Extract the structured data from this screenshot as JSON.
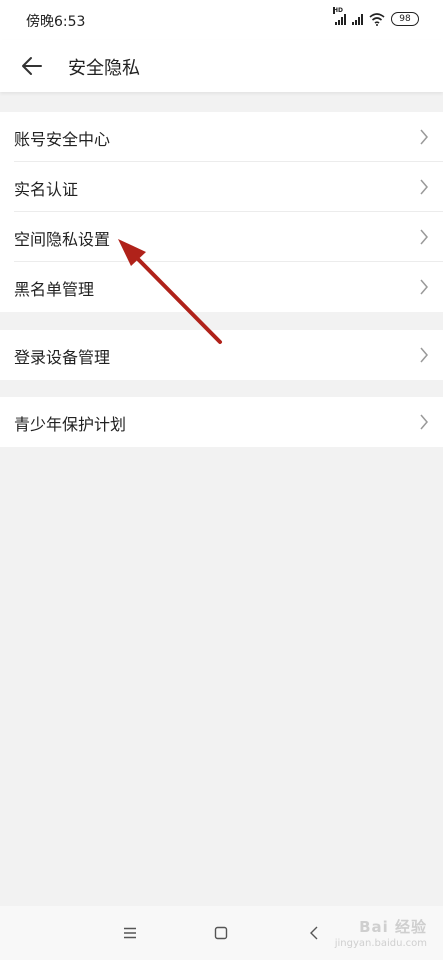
{
  "status_bar": {
    "time": "傍晚6:53",
    "signal_tag": "HD",
    "battery": "98"
  },
  "header": {
    "title": "安全隐私"
  },
  "groups": [
    {
      "items": [
        {
          "label": "账号安全中心"
        },
        {
          "label": "实名认证"
        },
        {
          "label": "空间隐私设置"
        },
        {
          "label": "黑名单管理"
        }
      ]
    },
    {
      "items": [
        {
          "label": "登录设备管理"
        }
      ]
    },
    {
      "items": [
        {
          "label": "青少年保护计划"
        }
      ]
    }
  ],
  "watermark": {
    "text": "Bai 经验",
    "sub": "jingyan.baidu.com"
  },
  "colors": {
    "background": "#f2f2f2",
    "annotation_arrow": "#b0221a"
  }
}
